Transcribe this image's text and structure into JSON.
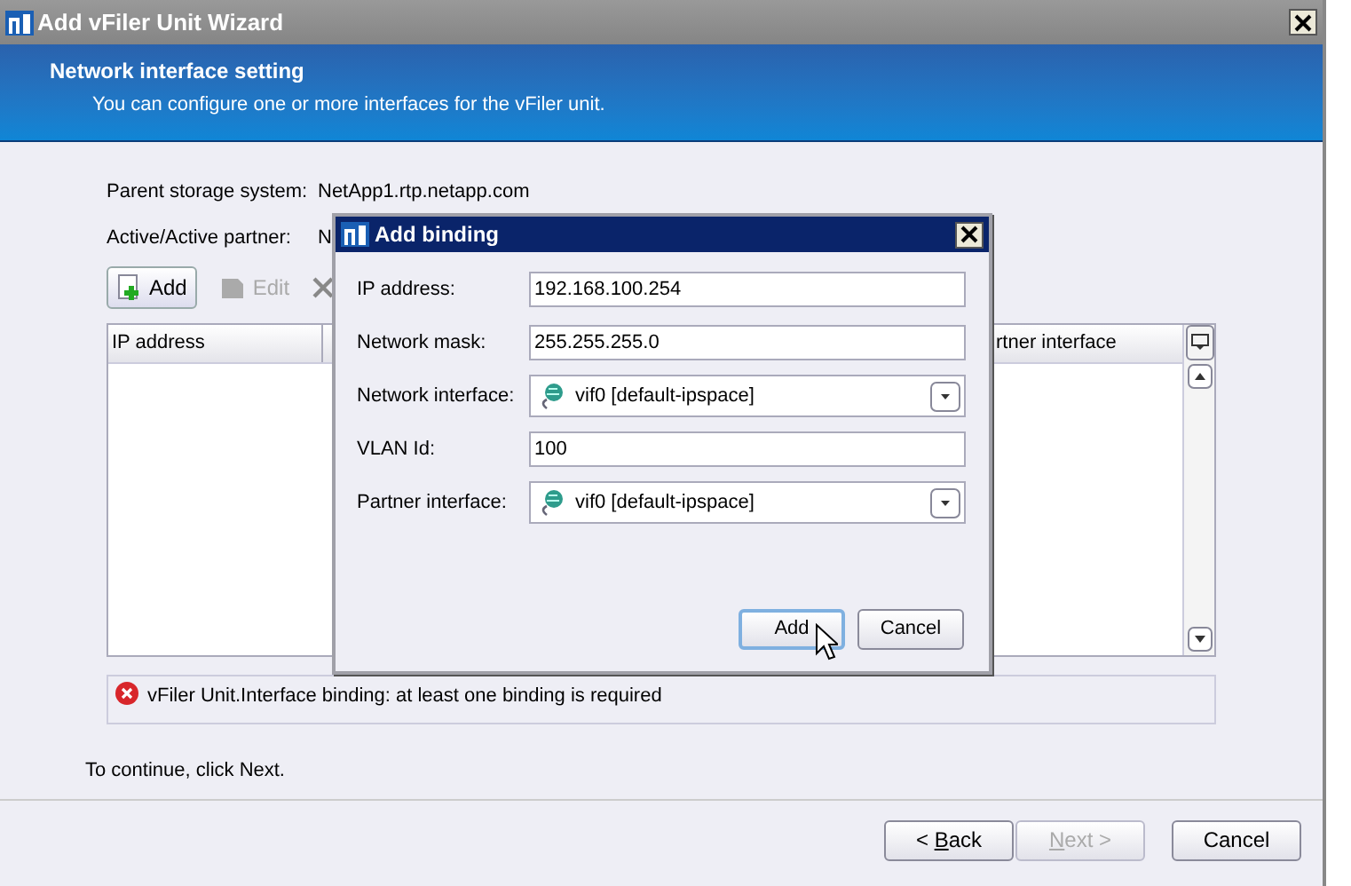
{
  "window": {
    "title": "Add vFiler Unit Wizard"
  },
  "header": {
    "title": "Network interface setting",
    "subtitle": "You can configure one or more interfaces for the vFiler unit."
  },
  "info": [
    {
      "label": "Parent storage system:",
      "value": "NetApp1.rtp.netapp.com"
    },
    {
      "label": "Active/Active partner:",
      "value": "N"
    }
  ],
  "toolbar": [
    {
      "kind": "add",
      "label": "Add",
      "disabled": false
    },
    {
      "kind": "edit",
      "label": "Edit",
      "disabled": true
    },
    {
      "kind": "delete",
      "disabled": false
    }
  ],
  "table": {
    "columns": [
      "IP address",
      "rtner interface"
    ]
  },
  "error": "vFiler Unit.Interface binding: at least one binding is required",
  "hint": "To continue, click Next.",
  "buttons": [
    {
      "label_before": "< ",
      "access_key": "B",
      "label_after": "ack",
      "disabled": false
    },
    {
      "access_key": "N",
      "label_after": "ext >",
      "disabled": true
    },
    {
      "label_before": "Cancel",
      "disabled": false
    }
  ],
  "dialog": {
    "title": "Add binding",
    "fields": [
      {
        "kind": "text",
        "label": "IP address:",
        "value": "192.168.100.254"
      },
      {
        "kind": "text",
        "label": "Network mask:",
        "value": "255.255.255.0"
      },
      {
        "kind": "select",
        "label": "Network interface:",
        "value": "vif0 [default-ipspace]"
      },
      {
        "kind": "text",
        "label": "VLAN Id:",
        "value": "100"
      },
      {
        "kind": "select",
        "label": "Partner interface:",
        "value": "vif0 [default-ipspace]"
      }
    ],
    "buttons": [
      {
        "label": "Add",
        "focused": true
      },
      {
        "label": "Cancel",
        "focused": false
      }
    ]
  }
}
